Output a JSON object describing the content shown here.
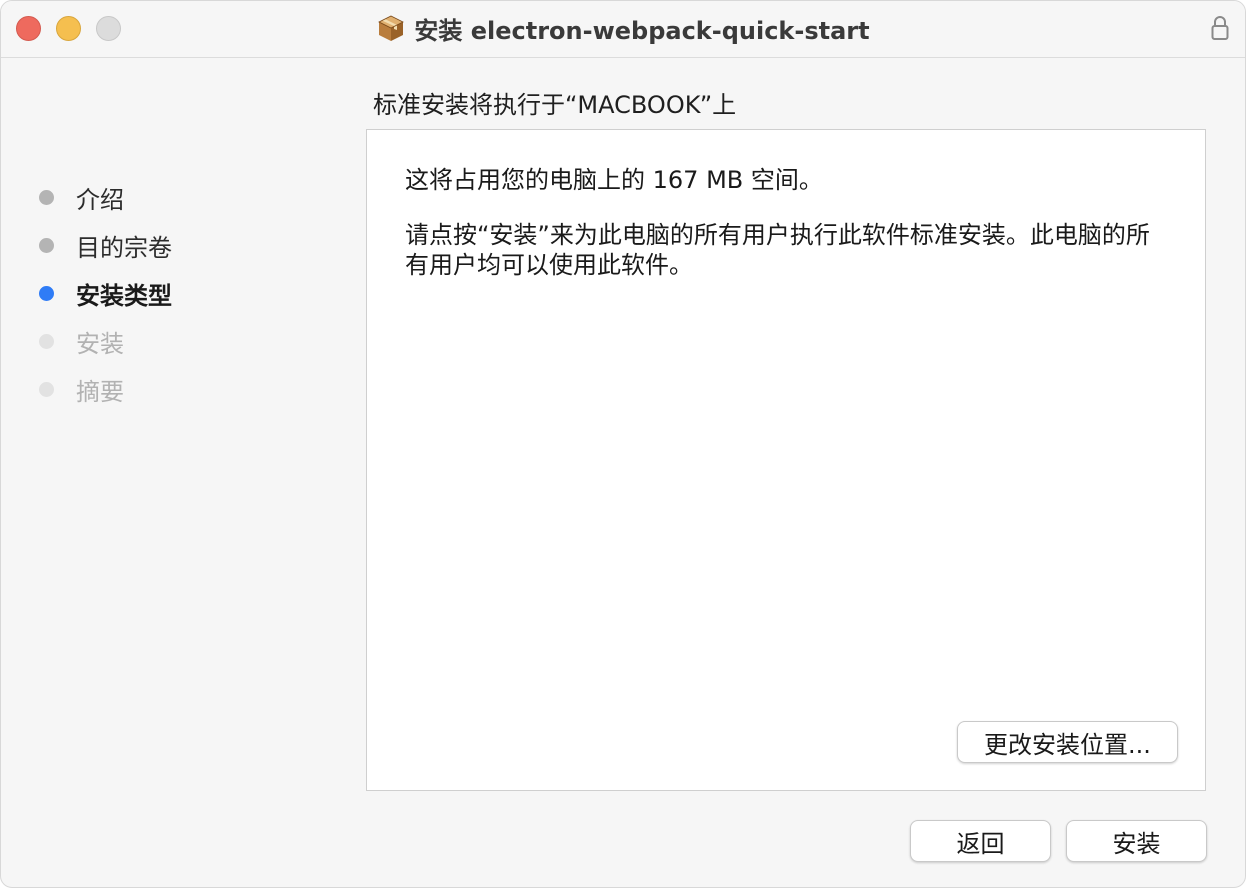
{
  "window": {
    "title": "安装 electron-webpack-quick-start",
    "icons": {
      "package": "package-icon",
      "lock": "lock-icon"
    }
  },
  "heading": "标准安装将执行于“MACBOOK”上",
  "steps": [
    {
      "label": "介绍",
      "state": "done"
    },
    {
      "label": "目的宗卷",
      "state": "done"
    },
    {
      "label": "安装类型",
      "state": "current"
    },
    {
      "label": "安装",
      "state": "todo"
    },
    {
      "label": "摘要",
      "state": "todo"
    }
  ],
  "content": {
    "space_text": "这将占用您的电脑上的 167 MB 空间。",
    "description": "请点按“安装”来为此电脑的所有用户执行此软件标准安装。此电脑的所有用户均可以使用此软件。",
    "change_location_button": "更改安装位置..."
  },
  "footer": {
    "back_button": "返回",
    "install_button": "安装"
  },
  "colors": {
    "accent": "#2f7cf6",
    "close": "#ee6a5e",
    "minimize": "#f5bf4f",
    "maximize_disabled": "#dcdcdc"
  }
}
